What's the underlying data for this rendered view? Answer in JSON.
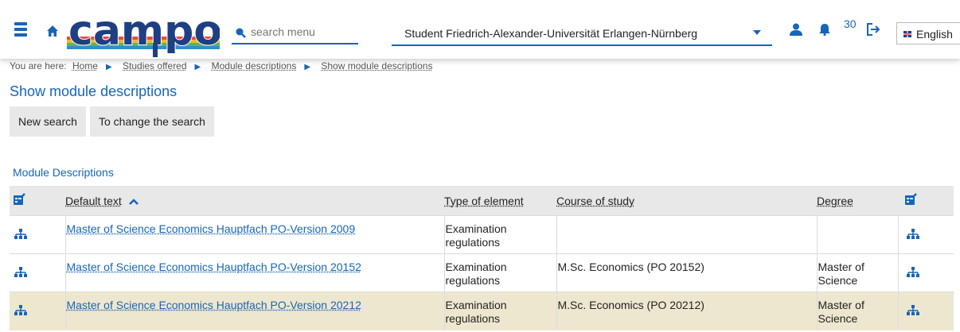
{
  "header": {
    "search_placeholder": "search menu",
    "role_select_value": "Student Friedrich-Alexander-Universität Erlangen-Nürnberg",
    "notification_count": "30",
    "language": "English"
  },
  "breadcrumb": {
    "prefix": "You are here:",
    "items": [
      "Home",
      "Studies offered",
      "Module descriptions",
      "Show module descriptions"
    ]
  },
  "page_title": "Show module descriptions",
  "buttons": {
    "new_search": "New search",
    "change_search": "To change the search"
  },
  "section_title": "Module Descriptions",
  "table": {
    "headers": {
      "default_text": "Default text",
      "type": "Type of element",
      "course": "Course of study",
      "degree": "Degree"
    },
    "rows": [
      {
        "text": "Master of Science Economics Hauptfach PO-Version 2009",
        "type_1": "Examination",
        "type_2": "regulations",
        "course": "",
        "degree_1": "",
        "degree_2": ""
      },
      {
        "text": "Master of Science Economics Hauptfach PO-Version 20152",
        "type_1": "Examination",
        "type_2": "regulations",
        "course": "M.Sc. Economics (PO 20152)",
        "degree_1": "Master of",
        "degree_2": "Science"
      },
      {
        "text": "Master of Science Economics Hauptfach PO-Version 20212",
        "type_1": "Examination",
        "type_2": "regulations",
        "course": "M.Sc. Economics (PO 20212)",
        "degree_1": "Master of",
        "degree_2": "Science"
      }
    ]
  },
  "colors": {
    "accent": "#1665b8",
    "highlight_row": "#eee7cf"
  },
  "icons": [
    "menu-icon",
    "home-icon",
    "search-icon",
    "chevron-down-icon",
    "user-icon",
    "bell-icon",
    "logout-icon",
    "flag-icon",
    "column-settings-icon",
    "sort-up-icon",
    "hierarchy-icon"
  ]
}
